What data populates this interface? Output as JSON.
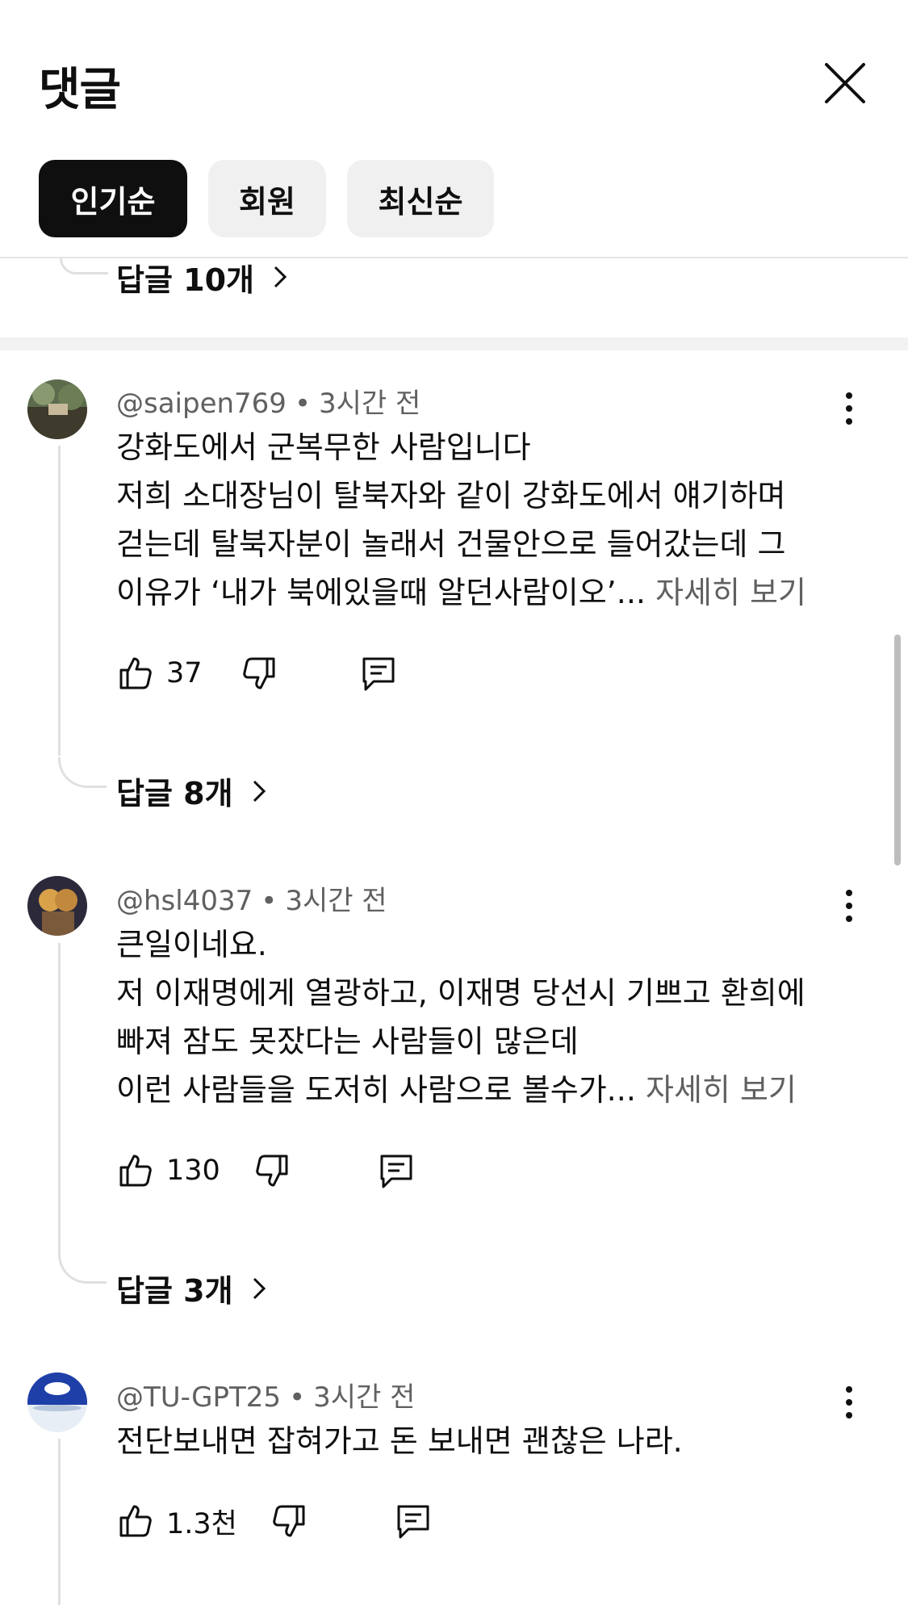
{
  "header": {
    "title": "댓글",
    "filters": [
      {
        "label": "인기순",
        "active": true
      },
      {
        "label": "회원",
        "active": false
      },
      {
        "label": "최신순",
        "active": false
      }
    ]
  },
  "prev_replies": "답글 10개",
  "comments": [
    {
      "author": "@saipen769",
      "time": "3시간 전",
      "lines": [
        "강화도에서 군복무한 사람입니다",
        "저희 소대장님이 탈북자와 같이 강화도에서 얘기하며",
        "걷는데 탈북자분이 놀래서 건물안으로 들어갔는데 그",
        "이유가 ‘내가 북에있을때 알던사람이오’..."
      ],
      "more": "자세히 보기",
      "likes": "37",
      "replies": "답글 8개"
    },
    {
      "author": "@hsl4037",
      "time": "3시간 전",
      "lines": [
        "큰일이네요.",
        "저 이재명에게 열광하고, 이재명 당선시 기쁘고 환희에",
        "빠져 잠도 못잤다는 사람들이 많은데",
        "이런 사람들을 도저히 사람으로 볼수가..."
      ],
      "more": "자세히 보기",
      "likes": "130",
      "replies": "답글 3개"
    },
    {
      "author": "@TU-GPT25",
      "time": "3시간 전",
      "lines": [
        "전단보내면 잡혀가고 돈 보내면 괜찮은 나라."
      ],
      "more": "",
      "likes": "1.3천",
      "replies": ""
    }
  ]
}
